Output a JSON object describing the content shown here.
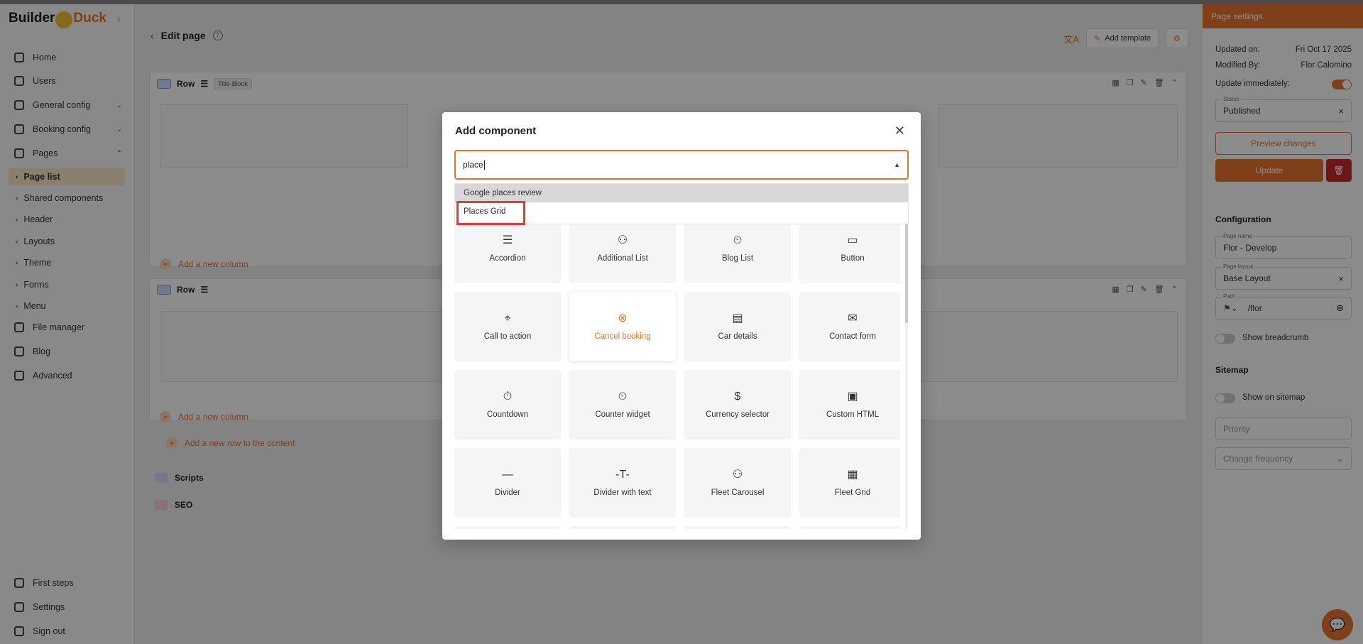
{
  "sidebar": {
    "logo_left": "Builder",
    "logo_right": "Duck",
    "items": [
      {
        "label": "Home",
        "icon": "home-icon"
      },
      {
        "label": "Users",
        "icon": "users-icon"
      },
      {
        "label": "General config",
        "icon": "gear-icon"
      },
      {
        "label": "Booking config",
        "icon": "booking-icon"
      },
      {
        "label": "Pages",
        "icon": "pages-icon"
      }
    ],
    "sub_items": [
      {
        "label": "Page list",
        "active": true
      },
      {
        "label": "Shared components"
      },
      {
        "label": "Header"
      },
      {
        "label": "Layouts"
      },
      {
        "label": "Theme"
      },
      {
        "label": "Forms"
      },
      {
        "label": "Menu"
      }
    ],
    "lower_items": [
      {
        "label": "File manager",
        "icon": "folder-icon"
      },
      {
        "label": "Blog",
        "icon": "blog-icon"
      },
      {
        "label": "Advanced",
        "icon": "advanced-icon"
      }
    ],
    "footer_items": [
      {
        "label": "First steps",
        "icon": "steps-icon"
      },
      {
        "label": "Settings",
        "icon": "settings-icon"
      },
      {
        "label": "Sign out",
        "icon": "signout-icon"
      }
    ]
  },
  "main": {
    "title": "Edit page",
    "add_template_label": "Add template",
    "rows": [
      {
        "label": "Row",
        "tag": "Title-Block"
      },
      {
        "label": "Row"
      }
    ],
    "add_column_label": "Add a new column",
    "add_row_label": "Add a new row to the content",
    "scripts_label": "Scripts",
    "seo_label": "SEO"
  },
  "right_panel": {
    "header": "Page settings",
    "updated_on_label": "Updated on:",
    "updated_on_value": "Fri Oct 17 2025",
    "modified_by_label": "Modified By:",
    "modified_by_value": "Flor Calomino",
    "update_immediately_label": "Update immediately:",
    "status_label": "Status",
    "status_value": "Published",
    "preview_label": "Preview changes",
    "update_label": "Update",
    "configuration_title": "Configuration",
    "page_name_label": "Page name",
    "page_name_value": "Flor - Develop",
    "page_layout_label": "Page layout",
    "page_layout_value": "Base Layout",
    "path_label": "Path",
    "path_value": "/flor",
    "show_breadcrumb_label": "Show breadcrumb",
    "sitemap_title": "Sitemap",
    "show_on_sitemap_label": "Show on sitemap",
    "priority_placeholder": "Priority",
    "change_frequency_placeholder": "Change frequency"
  },
  "modal": {
    "title": "Add component",
    "search_value": "place",
    "options": [
      {
        "label": "Google places review",
        "highlighted": true
      },
      {
        "label": "Places Grid",
        "boxed": true
      }
    ],
    "components": [
      {
        "label": "Accordion",
        "glyph": "☰"
      },
      {
        "label": "Additional List",
        "glyph": "⚇"
      },
      {
        "label": "Blog List",
        "glyph": "⏲"
      },
      {
        "label": "Button",
        "glyph": "▭"
      },
      {
        "label": "Call to action",
        "glyph": "⌖"
      },
      {
        "label": "Cancel booking",
        "glyph": "⊗",
        "selected": true
      },
      {
        "label": "Car details",
        "glyph": "▤"
      },
      {
        "label": "Contact form",
        "glyph": "✉"
      },
      {
        "label": "Countdown",
        "glyph": "⏱"
      },
      {
        "label": "Counter widget",
        "glyph": "⏲"
      },
      {
        "label": "Currency selector",
        "glyph": "$"
      },
      {
        "label": "Custom HTML",
        "glyph": "▣"
      },
      {
        "label": "Divider",
        "glyph": "—"
      },
      {
        "label": "Divider with text",
        "glyph": "-T-"
      },
      {
        "label": "Fleet Carousel",
        "glyph": "⚇"
      },
      {
        "label": "Fleet Grid",
        "glyph": "▦"
      }
    ]
  },
  "colors": {
    "accent": "#e8742c",
    "highlight_box": "#e53935"
  }
}
